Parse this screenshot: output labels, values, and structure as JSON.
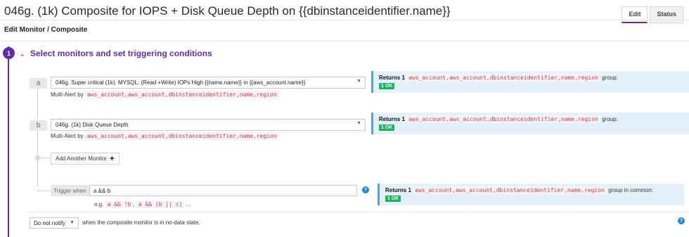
{
  "header": {
    "title": "046g. (1k) Composite for IOPS + Disk Queue Depth on {{dbinstanceidentifier.name}}",
    "tabs": [
      {
        "label": "Edit"
      },
      {
        "label": "Status"
      }
    ]
  },
  "breadcrumb": "Edit Monitor / Composite",
  "step": {
    "number": "1",
    "title": "Select monitors and set triggering conditions"
  },
  "monitors": [
    {
      "letter": "a",
      "name": "046g. Super critical (1k). MYSQL: (Read +Write) IOPs High {{name.name}} in {{aws_account.name}}",
      "multi_alert_label": "Multi-Alert by",
      "multi_alert_value": "aws_account,aws_account,dbinstanceidentifier,name,region",
      "returns_label": "Returns 1",
      "returns_groups": "aws_account,aws_account,dbinstanceidentifier,name,region",
      "returns_suffix": "group:",
      "status": "1 OK"
    },
    {
      "letter": "b",
      "name": "046g. (1k) Disk Queue Depth",
      "multi_alert_label": "Multi-Alert by",
      "multi_alert_value": "aws_account,aws_account,dbinstanceidentifier,name,region",
      "returns_label": "Returns 1",
      "returns_groups": "aws_account,aws_account,dbinstanceidentifier,name,region",
      "returns_suffix": "group:",
      "status": "1 OK"
    }
  ],
  "add_monitor_label": "Add Another Monitor",
  "trigger": {
    "label": "Trigger when",
    "value": "a && b",
    "example_prefix": "e.g.",
    "example_1": "a && !b",
    "example_sep": ",",
    "example_2": "a && (b || c)",
    "example_suffix": "...",
    "returns_label": "Returns 1",
    "returns_groups": "aws_account,aws_account,dbinstanceidentifier,name,region",
    "returns_suffix": "group in common:",
    "status": "1 OK"
  },
  "no_data": {
    "selected": "Do not notify",
    "text": "when the composite monitor is in no-data state."
  },
  "icons": {
    "help": "help-circle-icon",
    "chevron": "chevron-down-icon",
    "plus": "plus-icon",
    "caret": "caret-down-icon"
  },
  "colors": {
    "accent": "#632ca6",
    "ok": "#19b55d",
    "code": "#e0304e",
    "info_bg": "#e5f1fa"
  }
}
